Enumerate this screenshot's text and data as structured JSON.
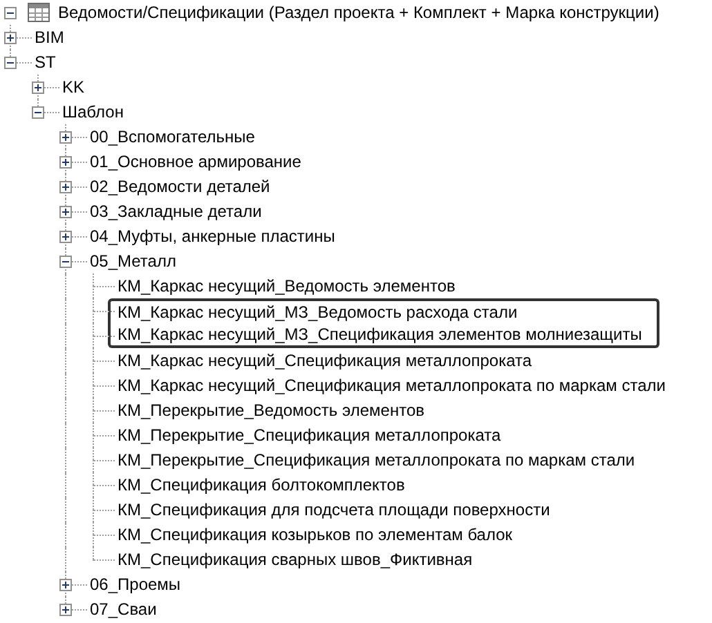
{
  "tree": {
    "label": "Ведомости/Спецификации (Раздел проекта + Комплект + Марка конструкции)",
    "expanded": true,
    "children": [
      {
        "label": "BIM",
        "expanded": false
      },
      {
        "label": "ST",
        "expanded": true,
        "children": [
          {
            "label": "KK",
            "expanded": false
          },
          {
            "label": "Шаблон",
            "expanded": true,
            "children": [
              {
                "label": "00_Вспомогательные",
                "expanded": false
              },
              {
                "label": "01_Основное армирование",
                "expanded": false
              },
              {
                "label": "02_Ведомости деталей",
                "expanded": false
              },
              {
                "label": "03_Закладные детали",
                "expanded": false
              },
              {
                "label": "04_Муфты, анкерные пластины",
                "expanded": false
              },
              {
                "label": "05_Металл",
                "expanded": true,
                "children": [
                  {
                    "label": "КМ_Каркас несущий_Ведомость элементов",
                    "highlighted": false
                  },
                  {
                    "label": "КМ_Каркас несущий_МЗ_Ведомость расхода стали",
                    "highlighted": true
                  },
                  {
                    "label": "КМ_Каркас несущий_МЗ_Спецификация элементов молниезащиты",
                    "highlighted": true
                  },
                  {
                    "label": "КМ_Каркас несущий_Спецификация металлопроката",
                    "highlighted": false
                  },
                  {
                    "label": "КМ_Каркас несущий_Спецификация металлопроката по маркам стали",
                    "highlighted": false
                  },
                  {
                    "label": "КМ_Перекрытие_Ведомость элементов",
                    "highlighted": false
                  },
                  {
                    "label": "КМ_Перекрытие_Спецификация металлопроката",
                    "highlighted": false
                  },
                  {
                    "label": "КМ_Перекрытие_Спецификация металлопроката по маркам стали",
                    "highlighted": false
                  },
                  {
                    "label": "КМ_Спецификация болтокомплектов",
                    "highlighted": false
                  },
                  {
                    "label": "КМ_Спецификация для подсчета площади поверхности",
                    "highlighted": false
                  },
                  {
                    "label": "КМ_Спецификация козырьков по элементам балок",
                    "highlighted": false
                  },
                  {
                    "label": "КМ_Спецификация сварных швов_Фиктивная",
                    "highlighted": false
                  }
                ]
              },
              {
                "label": "06_Проемы",
                "expanded": false
              },
              {
                "label": "07_Сваи",
                "expanded": false
              }
            ]
          }
        ]
      }
    ]
  }
}
